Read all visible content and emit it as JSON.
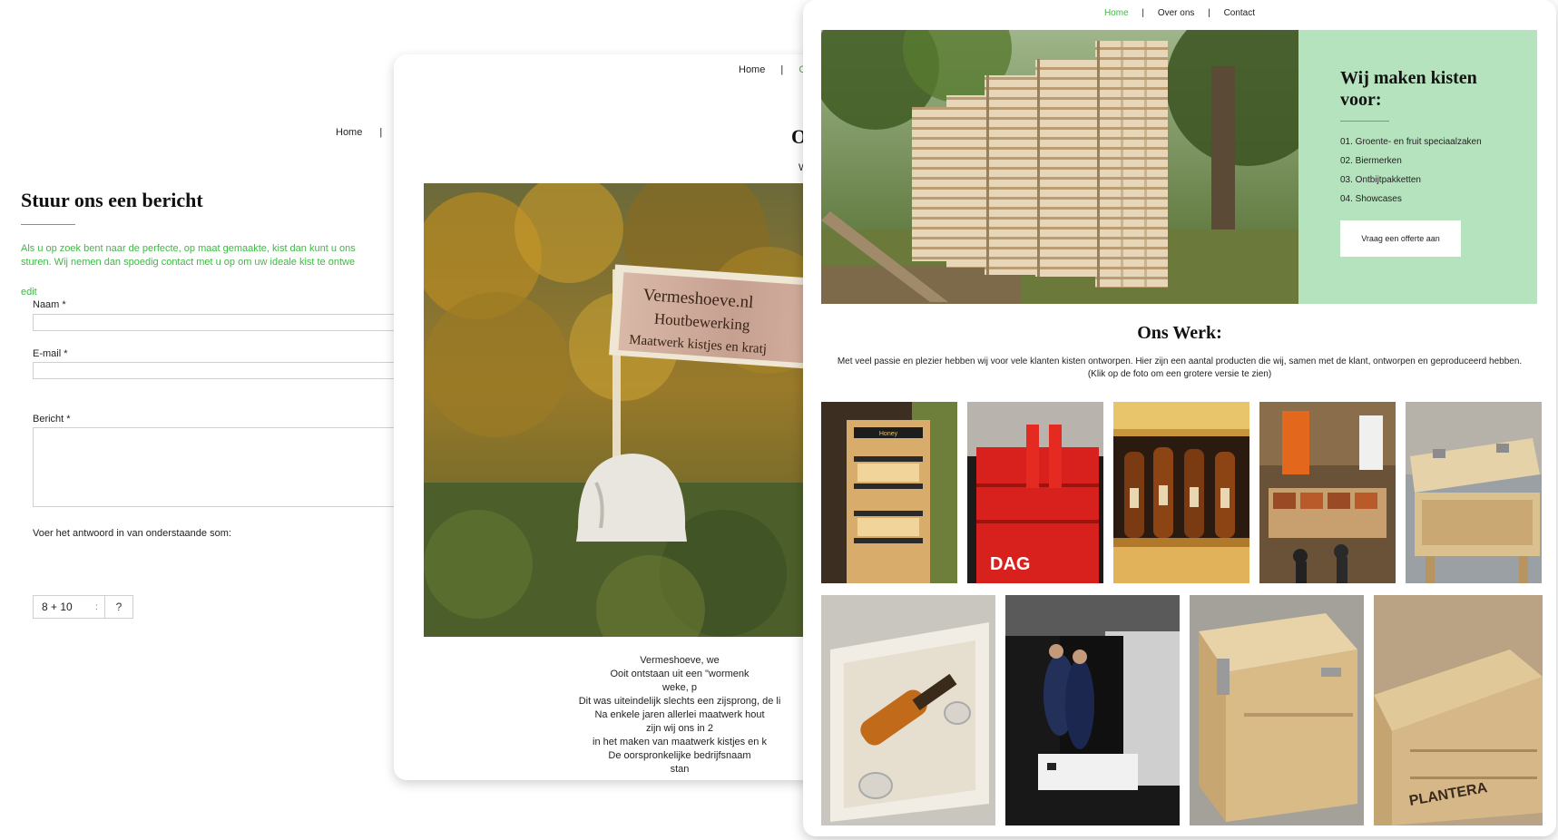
{
  "contact": {
    "nav": {
      "home": "Home",
      "sep": "|"
    },
    "title": "Stuur ons een bericht",
    "intro_line1": "Als u op zoek bent naar de perfecte, op maat gemaakte, kist dan kunt u ons",
    "intro_line2": "sturen. Wij nemen dan spoedig contact met u op om uw ideale kist te ontwe",
    "edit": "edit",
    "name_label": "Naam *",
    "email_label": "E-mail *",
    "message_label": "Bericht *",
    "captcha_label": "Voer het antwoord in van onderstaande som:",
    "captcha_sum": "8  +  10",
    "captcha_eq": ":",
    "captcha_answer": "?"
  },
  "about": {
    "nav": {
      "home": "Home",
      "sep": "|",
      "current": "C"
    },
    "title": "Ov",
    "subtitle": "W",
    "sign": {
      "line1": "Vermeshoeve.nl",
      "line2": "Houtbewerking",
      "line3": "Maatwerk kistjes en kratj"
    },
    "text_lines": [
      "Vermeshoeve, we",
      "Ooit ontstaan uit een \"wormenk",
      "weke, p",
      "Dit was uiteindelijk slechts een zijsprong, de li",
      "Na enkele jaren allerlei maatwerk hout",
      "zijn wij ons in 2",
      "in het maken van maatwerk kistjes en k",
      "De oorspronkelijke bedrijfsnaam",
      "stan"
    ]
  },
  "home": {
    "nav": {
      "home": "Home",
      "about": "Over ons",
      "contact": "Contact",
      "sep": "|"
    },
    "hero": {
      "title": "Wij maken kisten voor:",
      "items": [
        "01. Groente- en fruit speciaalzaken",
        "02. Biermerken",
        "03. Ontbijtpakketten",
        "04. Showcases"
      ],
      "button": "Vraag een offerte aan"
    },
    "work": {
      "title": "Ons Werk:",
      "text": "Met veel passie en plezier hebben wij voor vele klanten kisten ontworpen. Hier zijn een aantal producten die wij, samen met de klant, ontworpen en geproduceerd hebben.",
      "hint": "(Klik op de foto om een grotere versie te zien)",
      "thumb_texts": {
        "honey": "Honey",
        "dag": "DAG",
        "plantera": "PLANTERA"
      }
    }
  },
  "colors": {
    "accent": "#3fb845",
    "hero_panel": "#b5e3bd"
  }
}
